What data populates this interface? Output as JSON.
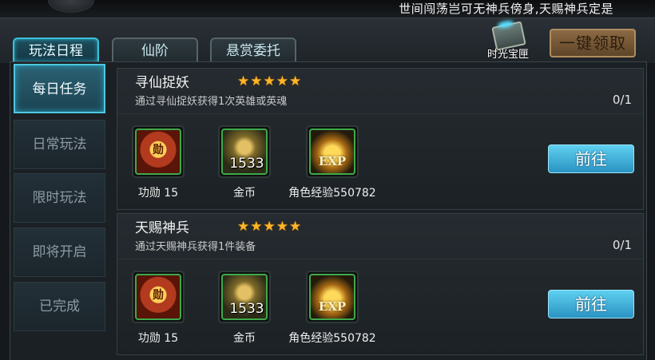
{
  "banner": {
    "text": "世间闯荡岂可无神兵傍身,天赐神兵定是"
  },
  "tabs": [
    {
      "label": "玩法日程",
      "active": true
    },
    {
      "label": "仙阶",
      "active": false
    },
    {
      "label": "悬赏委托",
      "active": false
    }
  ],
  "treasure": {
    "label": "时光宝匣",
    "icon": "treasure-chest-icon"
  },
  "claim_all_label": "一键领取",
  "sidebar": {
    "items": [
      {
        "label": "每日任务",
        "active": true
      },
      {
        "label": "日常玩法",
        "active": false
      },
      {
        "label": "限时玩法",
        "active": false
      },
      {
        "label": "即将开启",
        "active": false
      },
      {
        "label": "已完成",
        "active": false
      }
    ]
  },
  "quests": [
    {
      "title": "寻仙捉妖",
      "stars": "★★★★★",
      "star_count": 5,
      "description": "通过寻仙捉妖获得1次英雄或英魂",
      "progress": "0/1",
      "rewards": [
        {
          "icon": "merit-medal-icon",
          "glyph": "勋",
          "count": "",
          "label": "功勋 15"
        },
        {
          "icon": "gold-coins-icon",
          "glyph": "",
          "count": "1533",
          "label": "金币"
        },
        {
          "icon": "exp-icon",
          "glyph": "EXP",
          "count": "",
          "label": "角色经验550782"
        }
      ],
      "action_label": "前往"
    },
    {
      "title": "天赐神兵",
      "stars": "★★★★★",
      "star_count": 5,
      "description": "通过天赐神兵获得1件装备",
      "progress": "0/1",
      "rewards": [
        {
          "icon": "merit-medal-icon",
          "glyph": "勋",
          "count": "",
          "label": "功勋 15"
        },
        {
          "icon": "gold-coins-icon",
          "glyph": "",
          "count": "1533",
          "label": "金币"
        },
        {
          "icon": "exp-icon",
          "glyph": "EXP",
          "count": "",
          "label": "角色经验550782"
        }
      ],
      "action_label": "前往"
    }
  ],
  "colors": {
    "accent_cyan": "#3ac1d9",
    "star_gold": "#ffb52a",
    "go_button": "#2b93c2",
    "claim_button": "#8b6a43",
    "reward_border": "#3fa94a"
  }
}
